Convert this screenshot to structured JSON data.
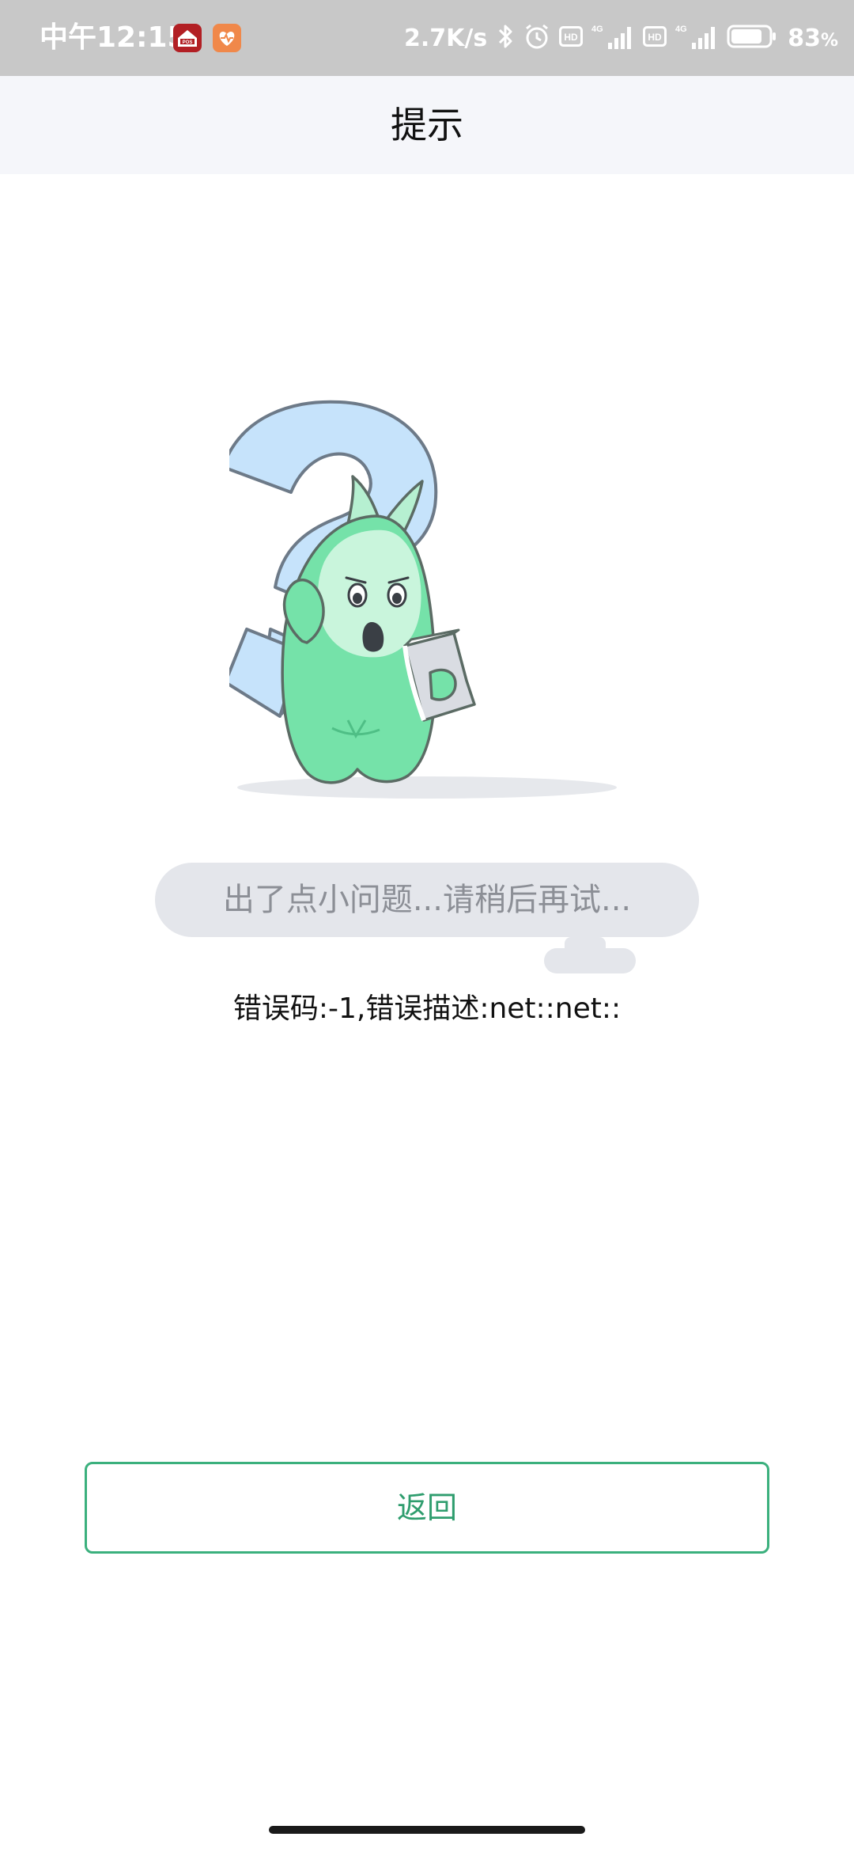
{
  "status_bar": {
    "time": "中午12:15",
    "network_speed": "2.7K/s",
    "battery_percent": "83",
    "battery_unit": "%",
    "icons": [
      "pos-app-icon",
      "health-app-icon",
      "bluetooth-icon",
      "alarm-icon",
      "hd-icon",
      "signal-4g-icon",
      "hd-icon",
      "signal-4g-icon",
      "battery-icon"
    ],
    "battery_level": 0.83
  },
  "header": {
    "title": "提示"
  },
  "main": {
    "bubble_text": "出了点小问题...请稍后再试...",
    "error_text": "错误码:-1,错误描述:net::net::",
    "illustration": "confused-mascot-with-question-mark"
  },
  "footer": {
    "back_label": "返回"
  },
  "colors": {
    "status_bar_bg": "#c8c8c8",
    "title_bar_bg": "#f5f6fa",
    "accent_green": "#3bb07d",
    "bubble_bg": "#e4e6eb",
    "bubble_text": "#8c8f96"
  }
}
